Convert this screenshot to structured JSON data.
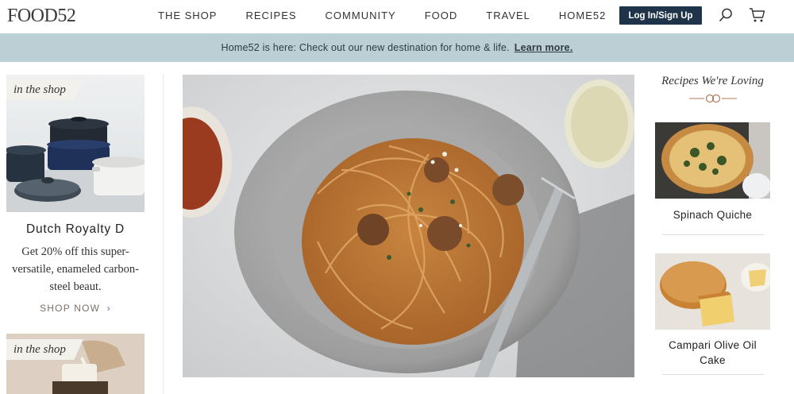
{
  "header": {
    "logo": "FOOD52",
    "nav": [
      "THE SHOP",
      "RECIPES",
      "COMMUNITY",
      "FOOD",
      "TRAVEL",
      "HOME52"
    ],
    "login_label": "Log In/Sign Up"
  },
  "banner": {
    "text": "Home52 is here: Check out our new destination for home & life.",
    "link": "Learn more."
  },
  "shop_cards": [
    {
      "tag": "in the shop",
      "title": "Dutch Royalty D",
      "description": "Get 20% off this super-versatile, enameled carbon-steel beaut.",
      "cta": "SHOP NOW"
    },
    {
      "tag": "in the shop"
    }
  ],
  "recipes_loving": {
    "heading": "Recipes We're Loving",
    "items": [
      {
        "title": "Spinach Quiche"
      },
      {
        "title": "Campari Olive Oil Cake"
      }
    ]
  },
  "colors": {
    "banner_bg": "#bccfd4",
    "login_bg": "#1f3448",
    "ornament": "#b07a5b"
  }
}
